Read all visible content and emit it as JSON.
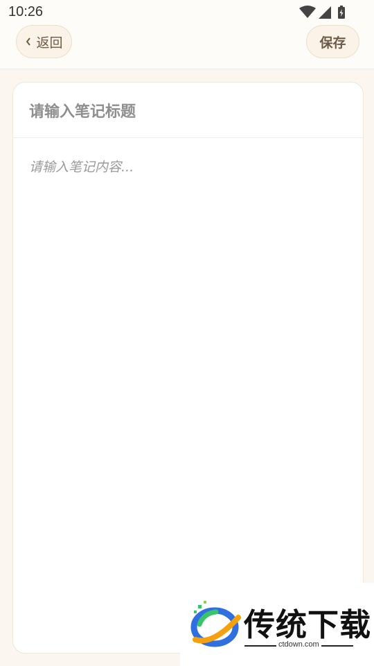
{
  "status_bar": {
    "time": "10:26",
    "icons": [
      "wifi-icon",
      "signal-icon",
      "battery-charging-icon"
    ]
  },
  "toolbar": {
    "back_label": "返回",
    "save_label": "保存"
  },
  "editor": {
    "title_placeholder": "请输入笔记标题",
    "content_placeholder": "请输入笔记内容..."
  },
  "watermark": {
    "brand": "传统下载",
    "url": "ctdown.com"
  },
  "colors": {
    "background": "#fbf6ef",
    "button_bg": "#fbf3e7",
    "button_text": "#6b5a45",
    "card": "#ffffff"
  }
}
